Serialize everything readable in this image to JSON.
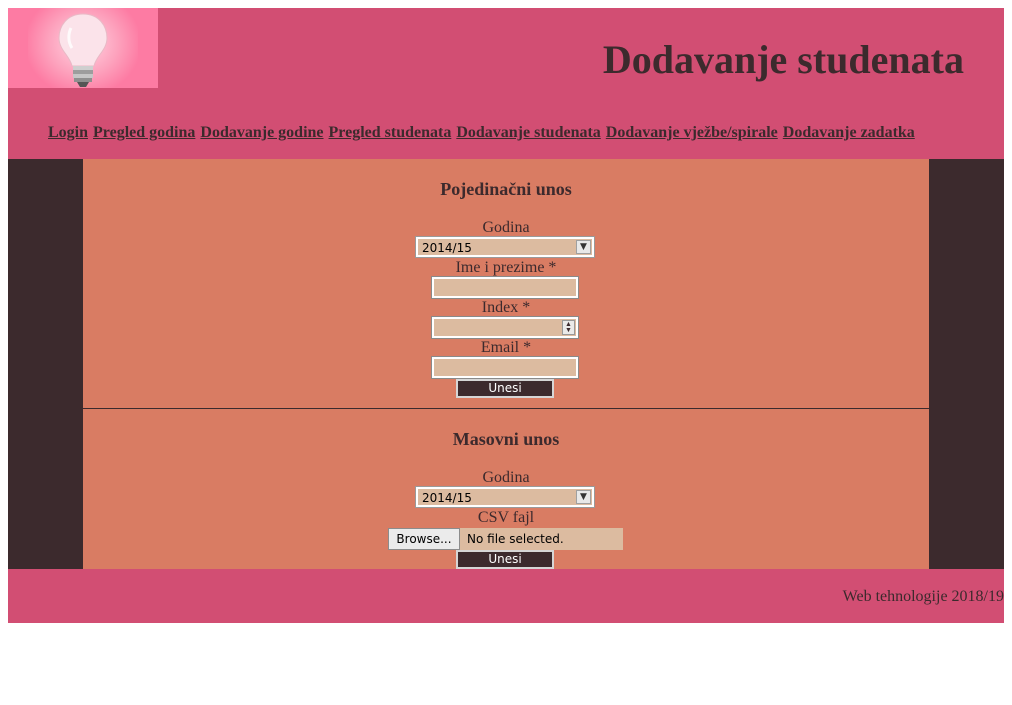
{
  "header": {
    "title": "Dodavanje studenata",
    "logo": "lightbulb-icon"
  },
  "nav": [
    {
      "label": "Login"
    },
    {
      "label": "Pregled godina"
    },
    {
      "label": "Dodavanje godine"
    },
    {
      "label": "Pregled studenata"
    },
    {
      "label": "Dodavanje studenata"
    },
    {
      "label": "Dodavanje vježbe/spirale"
    },
    {
      "label": "Dodavanje zadatka"
    }
  ],
  "single": {
    "title": "Pojedinačni unos",
    "year_label": "Godina",
    "year_value": "2014/15",
    "name_label": "Ime i prezime *",
    "name_value": "",
    "index_label": "Index *",
    "index_value": "",
    "email_label": "Email *",
    "email_value": "",
    "submit": "Unesi"
  },
  "bulk": {
    "title": "Masovni unos",
    "year_label": "Godina",
    "year_value": "2014/15",
    "csv_label": "CSV fajl",
    "browse": "Browse...",
    "no_file": "No file selected.",
    "submit": "Unesi"
  },
  "footer": {
    "text": "Web tehnologije 2018/19"
  },
  "colors": {
    "header_bg": "#d24e73",
    "content_bg": "#d97c63",
    "side_bg": "#3c2a2d",
    "input_bg": "#dcbba0",
    "logo_bg": "#fd7ba3"
  }
}
